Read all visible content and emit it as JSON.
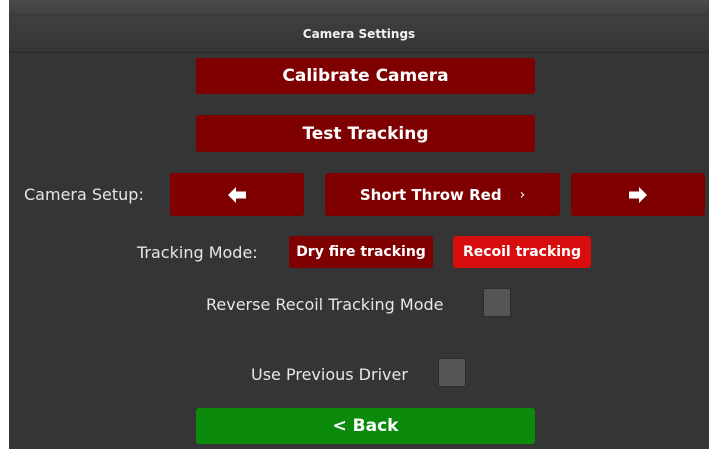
{
  "window": {
    "title": "Camera Settings"
  },
  "buttons": {
    "calibrate": "Calibrate Camera",
    "test_tracking": "Test Tracking",
    "back": "< Back"
  },
  "camera_setup": {
    "label": "Camera Setup:",
    "selected": "Short Throw Red",
    "chevron": "›",
    "prev_icon": "arrow-left-icon",
    "next_icon": "arrow-right-icon"
  },
  "tracking_mode": {
    "label": "Tracking Mode:",
    "options": [
      "Dry fire tracking",
      "Recoil tracking"
    ],
    "active": "Recoil tracking"
  },
  "options": {
    "reverse_recoil_label": "Reverse Recoil Tracking Mode",
    "reverse_recoil_checked": false,
    "use_previous_driver_label": "Use Previous Driver",
    "use_previous_driver_checked": false
  },
  "colors": {
    "button_dark_red": "#7f0000",
    "button_bright_red": "#d80d0d",
    "button_green": "#0b8a0b",
    "background": "#353535"
  }
}
